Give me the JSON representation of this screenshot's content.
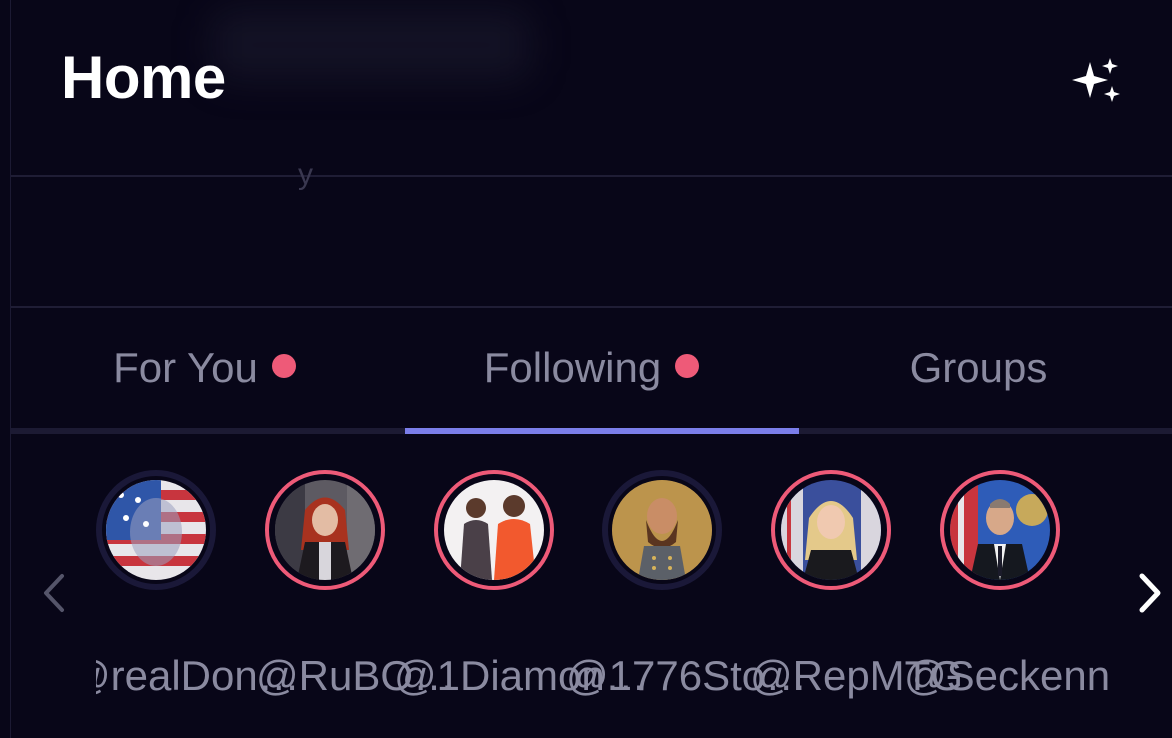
{
  "header": {
    "title": "Home",
    "sparkle_icon": "sparkle-icon"
  },
  "tabs": [
    {
      "label": "For You",
      "has_dot": true,
      "active": false
    },
    {
      "label": "Following",
      "has_dot": true,
      "active": true
    },
    {
      "label": "Groups",
      "has_dot": false,
      "active": false
    }
  ],
  "colors": {
    "background": "#080618",
    "accent": "#7b7eea",
    "notification_dot": "#ee5a78",
    "tab_text": "#8a8aa0"
  },
  "stories": {
    "prev_icon": "chevron-left-icon",
    "next_icon": "chevron-right-icon",
    "items": [
      {
        "handle": "@realDon…",
        "unseen": false
      },
      {
        "handle": "@RuBO…",
        "unseen": true
      },
      {
        "handle": "@1Diamon…",
        "unseen": true
      },
      {
        "handle": "@1776Sto…",
        "unseen": false
      },
      {
        "handle": "@RepMTG",
        "unseen": true
      },
      {
        "handle": "@Seckenn…",
        "unseen": true
      }
    ]
  }
}
